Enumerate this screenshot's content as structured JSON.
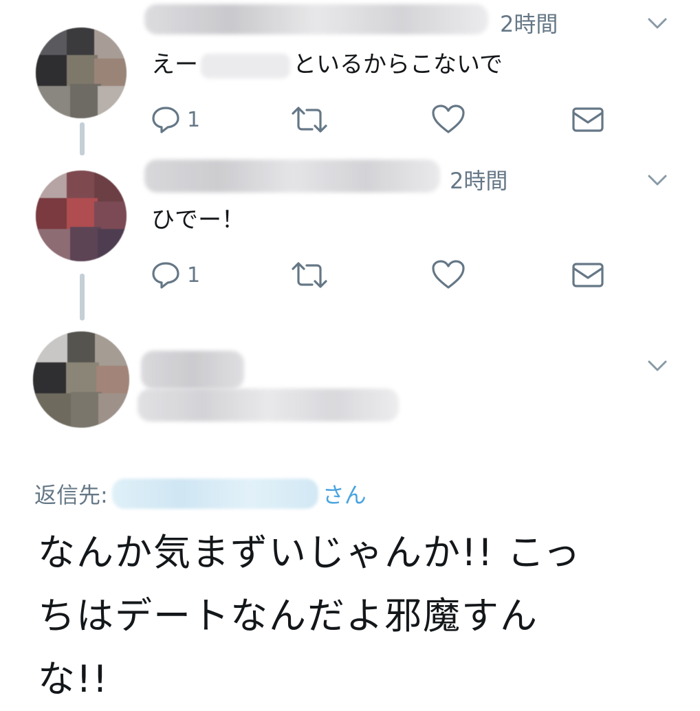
{
  "tweets": [
    {
      "time": "2時間",
      "text_prefix": "えー",
      "text_suffix": "といるからこないで",
      "reply_count": "1"
    },
    {
      "time": "2時間",
      "text": "ひでー！",
      "reply_count": "1"
    },
    {
      "time": ""
    }
  ],
  "icons": {
    "reply": "reply-icon",
    "retweet": "retweet-icon",
    "like": "heart-icon",
    "dm": "envelope-icon",
    "menu": "chevron-down-icon"
  },
  "reply_to": {
    "label": "返信先:",
    "suffix": "さん"
  },
  "main_tweet": {
    "line1": "なんか気まずいじゃんか!! こっ",
    "line2": "ちはデートなんだよ邪魔すん",
    "line3": "な!!"
  },
  "colors": {
    "text": "#14171a",
    "muted": "#657786",
    "link": "#4aa3df",
    "thread_line": "#c4cfd6"
  }
}
